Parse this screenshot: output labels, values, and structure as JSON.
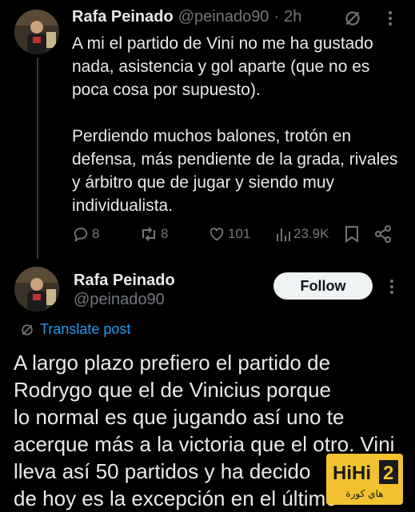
{
  "tweet1": {
    "author": "Rafa Peinado",
    "handle": "@peinado90",
    "sep": "·",
    "time": "2h",
    "text": "A mi el partido de Vini no me ha gustado nada, asistencia y gol aparte (que no es poca cosa por supuesto).\n\nPerdiendo muchos balones, trotón en defensa, más pendiente de la grada, rivales y árbitro que de jugar y siendo muy individualista.",
    "replies": "8",
    "retweets": "8",
    "likes": "101",
    "views": "23.9K"
  },
  "tweet2": {
    "author": "Rafa Peinado",
    "handle": "@peinado90",
    "follow_label": "Follow",
    "translate_label": "Translate post",
    "text_lines": [
      "A largo plazo prefiero el partido de",
      "Rodrygo que el de Vinicius porque",
      "lo normal es que jugando así uno te",
      "acerque más a la victoria que el otro. Vini",
      "lleva así 50 partidos y ha decido",
      "de hoy es la excepción en el último"
    ]
  },
  "watermark": {
    "text": "HiHi2",
    "arabic": "هاي كورة"
  },
  "colors": {
    "accent": "#1d9bf0",
    "background": "#000000",
    "muted": "#71767b"
  }
}
